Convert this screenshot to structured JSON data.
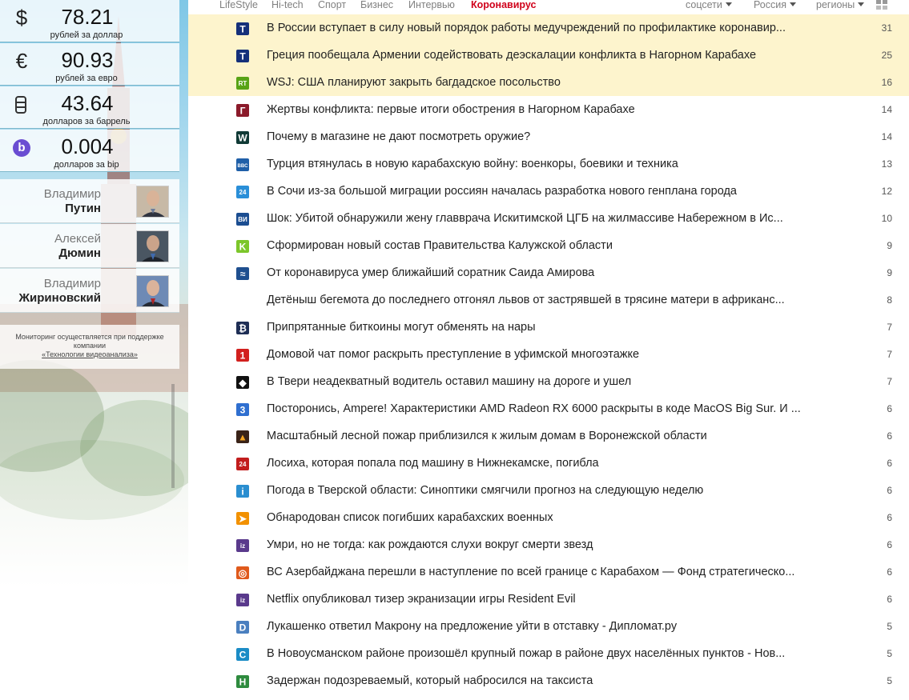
{
  "sidebar": {
    "rates": [
      {
        "icon": "dollar-icon",
        "symbol": "$",
        "value": "78.21",
        "caption": "рублей за доллар"
      },
      {
        "icon": "euro-icon",
        "symbol": "€",
        "value": "90.93",
        "caption": "рублей за евро"
      },
      {
        "icon": "barrel-icon",
        "symbol": "",
        "value": "43.64",
        "caption": "долларов за баррель"
      },
      {
        "icon": "bip-icon",
        "symbol": "b",
        "value": "0.004",
        "caption": "долларов за bip"
      }
    ],
    "people": [
      {
        "first": "Владимир",
        "last": "Путин"
      },
      {
        "first": "Алексей",
        "last": "Дюмин"
      },
      {
        "first": "Владимир",
        "last": "Жириновский"
      }
    ],
    "monitor": {
      "text": "Мониторинг осуществляется при поддержке компании",
      "link": "«Технологии видеоанализа»"
    }
  },
  "nav": {
    "categories": [
      "LifeStyle",
      "Hi-tech",
      "Спорт",
      "Бизнес",
      "Интервью",
      "Коронавирус"
    ],
    "active": "Коронавирус",
    "social": "соцсети",
    "country": "Россия",
    "regions": "регионы"
  },
  "news": [
    {
      "icon": "tass-icon",
      "title": "В России вступает в силу новый порядок работы медучреждений по профилактике коронавир...",
      "count": "31",
      "highlight": true,
      "bg": "#15307a"
    },
    {
      "icon": "tass-icon",
      "title": "Греция пообещала Армении содействовать деэскалации конфликта в Нагорном Карабахе",
      "count": "25",
      "highlight": true,
      "bg": "#15307a"
    },
    {
      "icon": "rt-icon",
      "title": "WSJ: США планируют закрыть багдадское посольство",
      "count": "16",
      "highlight": true,
      "bg": "#58a316"
    },
    {
      "icon": "gazeta-icon",
      "title": "Жертвы конфликта: первые итоги обострения в Нагорном Карабахе",
      "count": "14",
      "highlight": false,
      "bg": "#8b1a2a"
    },
    {
      "icon": "w-icon",
      "title": "Почему в магазине не дают посмотреть оружие?",
      "count": "14",
      "highlight": false,
      "bg": "#103a36"
    },
    {
      "icon": "bbc-icon",
      "title": "Турция втянулась в новую карабахскую войну: военкоры, боевики и техника",
      "count": "13",
      "highlight": false,
      "bg": "#1f5fa8"
    },
    {
      "icon": "24-icon",
      "title": "В Сочи из-за большой миграции россиян началась разработка нового генплана города",
      "count": "12",
      "highlight": false,
      "bg": "#2a8fd8"
    },
    {
      "icon": "vi-icon",
      "title": "Шок: Убитой обнаружили жену главврача Искитимской ЦГБ на жилмассиве Набережном в Ис...",
      "count": "10",
      "highlight": false,
      "bg": "#1b4d91"
    },
    {
      "icon": "k-icon",
      "title": "Сформирован новый состав Правительства Калужской области",
      "count": "9",
      "highlight": false,
      "bg": "#7cc62a"
    },
    {
      "icon": "ship-icon",
      "title": "От коронавируса умер ближайший соратник Саида Амирова",
      "count": "9",
      "highlight": false,
      "bg": "#1f4f8f"
    },
    {
      "icon": "",
      "title": "Детёныш бегемота до последнего отгонял львов от застрявшей в трясине матери в африканс...",
      "count": "8",
      "highlight": false,
      "bg": ""
    },
    {
      "icon": "bitcoin-icon",
      "title": "Припрятанные биткоины могут обменять на нары",
      "count": "7",
      "highlight": false,
      "bg": "#1e2e55"
    },
    {
      "icon": "one-icon",
      "title": "Домовой чат помог раскрыть преступление в уфимской многоэтажке",
      "count": "7",
      "highlight": false,
      "bg": "#d2201e"
    },
    {
      "icon": "diamond-icon",
      "title": "В Твери неадекватный водитель оставил машину на дороге и ушел",
      "count": "7",
      "highlight": false,
      "bg": "#111111"
    },
    {
      "icon": "three-icon",
      "title": "Посторонись, Ampere! Характеристики AMD Radeon RX 6000 раскрыты в коде MacOS Big Sur. И ...",
      "count": "6",
      "highlight": false,
      "bg": "#2f6fd0"
    },
    {
      "icon": "fire-icon",
      "title": "Масштабный лесной пожар приблизился к жилым домам в Воронежской области",
      "count": "6",
      "highlight": false,
      "bg": "#3a2318"
    },
    {
      "icon": "24kz-icon",
      "title": "Лосиха, которая попала под машину в Нижнекамске, погибла",
      "count": "6",
      "highlight": false,
      "bg": "#c21d1d"
    },
    {
      "icon": "figure-icon",
      "title": "Погода в Тверской области: Синоптики смягчили прогноз на следующую неделю",
      "count": "6",
      "highlight": false,
      "bg": "#2a8ed0"
    },
    {
      "icon": "sputnik-icon",
      "title": "Обнародован список погибших карабахских военных",
      "count": "6",
      "highlight": false,
      "bg": "#f29100"
    },
    {
      "icon": "iz-icon",
      "title": "Умри, но не тогда: как рождаются слухи вокруг смерти звезд",
      "count": "6",
      "highlight": false,
      "bg": "#5a3a8c"
    },
    {
      "icon": "target-icon",
      "title": "ВС Азербайджана перешли в наступление по всей границе с Карабахом — Фонд стратегическо...",
      "count": "6",
      "highlight": false,
      "bg": "#e05a1c"
    },
    {
      "icon": "iz-icon",
      "title": "Netflix опубликовал тизер экранизации игры Resident Evil",
      "count": "6",
      "highlight": false,
      "bg": "#5a3a8c"
    },
    {
      "icon": "diplomat-icon",
      "title": "Лукашенко ответил Макрону на предложение уйти в отставку - Дипломат.ру",
      "count": "5",
      "highlight": false,
      "bg": "#4a7fbf"
    },
    {
      "icon": "c-icon",
      "title": "В Новоусманском районе произошёл крупный пожар в районе двух населённых пунктов - Нов...",
      "count": "5",
      "highlight": false,
      "bg": "#1b8cc6"
    },
    {
      "icon": "h-icon",
      "title": "Задержан подозреваемый, который набросился на таксиста",
      "count": "5",
      "highlight": false,
      "bg": "#2e8b3e"
    }
  ]
}
